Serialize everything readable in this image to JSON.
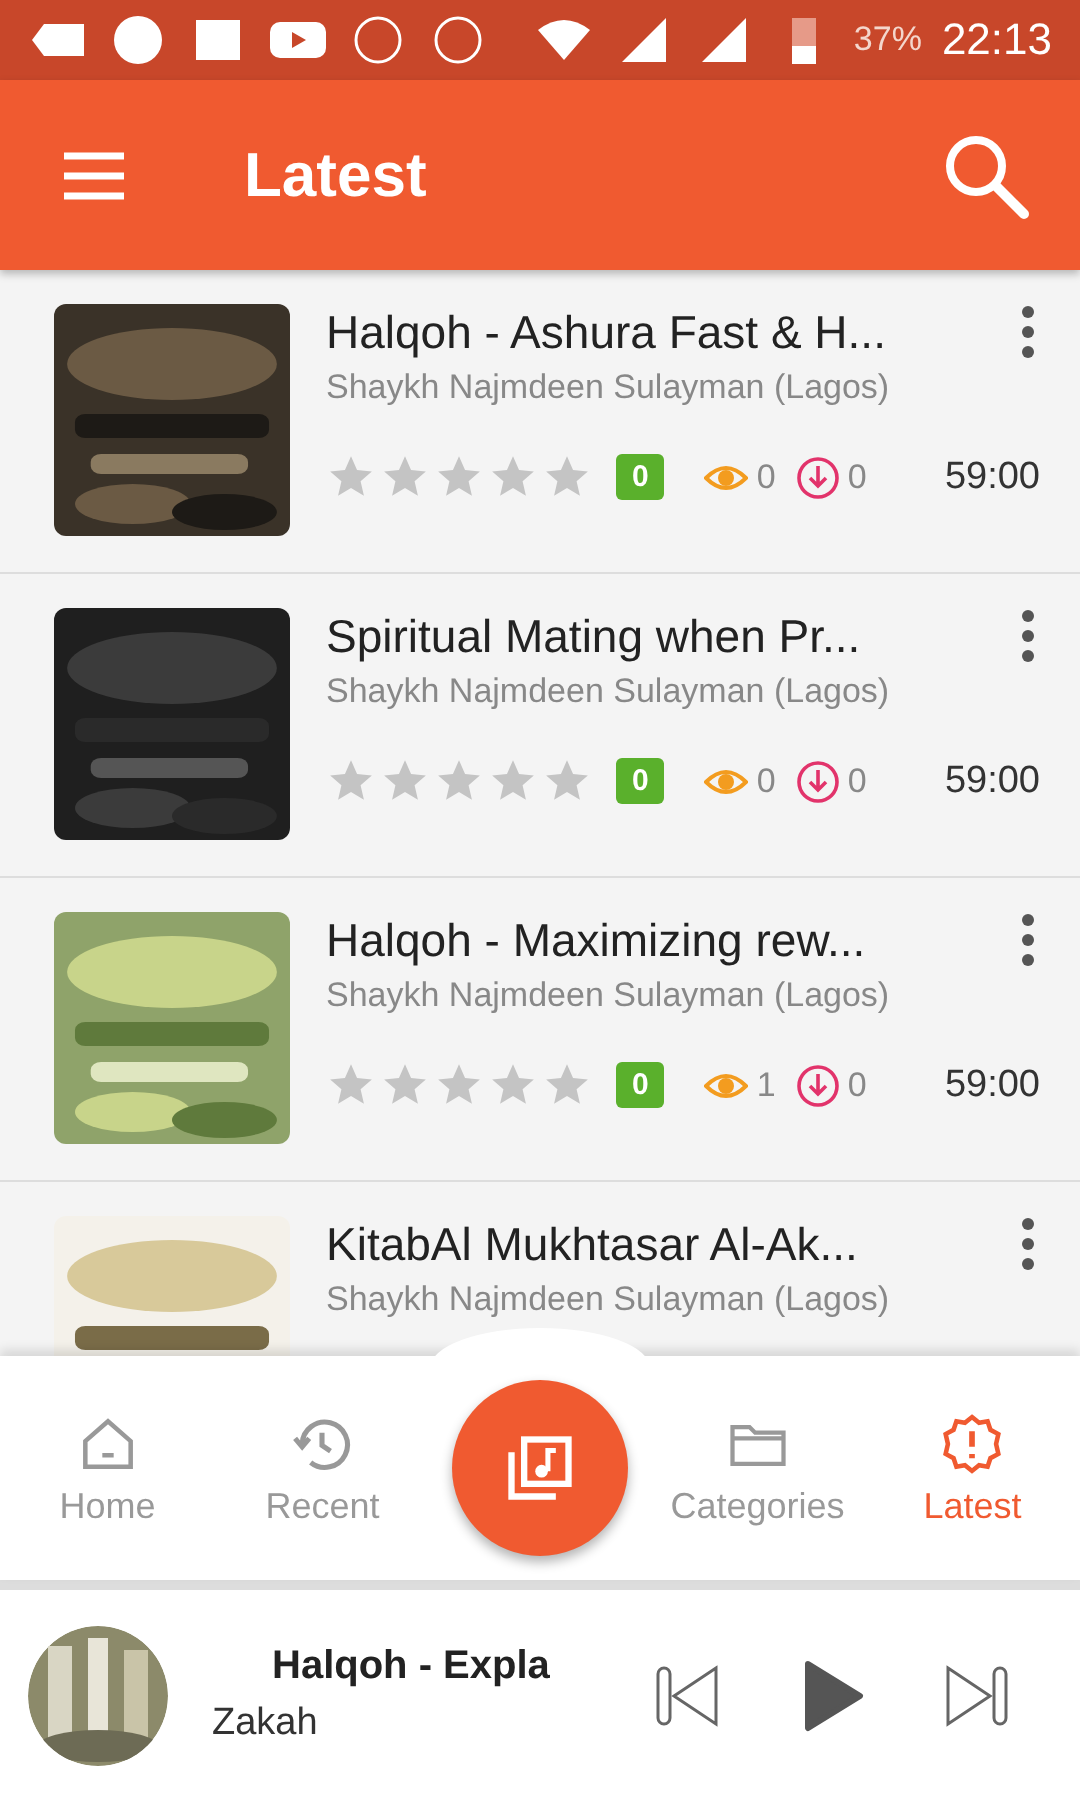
{
  "status_bar": {
    "battery": "37%",
    "time": "22:13"
  },
  "app_bar": {
    "title": "Latest"
  },
  "items": [
    {
      "kind": "picture",
      "title": "Halqoh - Ashura Fast & H...",
      "speaker": "Shaykh Najmdeen Sulayman (Lagos)",
      "stars": 0,
      "badge": "0",
      "views": "0",
      "downloads": "0",
      "duration": "59:00"
    },
    {
      "kind": "picture",
      "title": "Spiritual Mating when Pr...",
      "speaker": "Shaykh Najmdeen Sulayman (Lagos)",
      "stars": 0,
      "badge": "0",
      "views": "0",
      "downloads": "0",
      "duration": "59:00"
    },
    {
      "kind": "picture",
      "title": "Halqoh - Maximizing rew...",
      "speaker": "Shaykh Najmdeen Sulayman (Lagos)",
      "stars": 0,
      "badge": "0",
      "views": "1",
      "downloads": "0",
      "duration": "59:00"
    },
    {
      "kind": "picture",
      "title": "KitabAl Mukhtasar Al-Ak...",
      "speaker": "Shaykh Najmdeen Sulayman (Lagos)"
    }
  ],
  "bottom_nav": [
    {
      "label": "Home",
      "selected": false
    },
    {
      "label": "Recent",
      "selected": false
    },
    {
      "label": "Categories",
      "selected": false
    },
    {
      "label": "Latest",
      "selected": true
    }
  ],
  "player": {
    "title": "Halqoh - Expla",
    "subtitle": "Zakah"
  }
}
